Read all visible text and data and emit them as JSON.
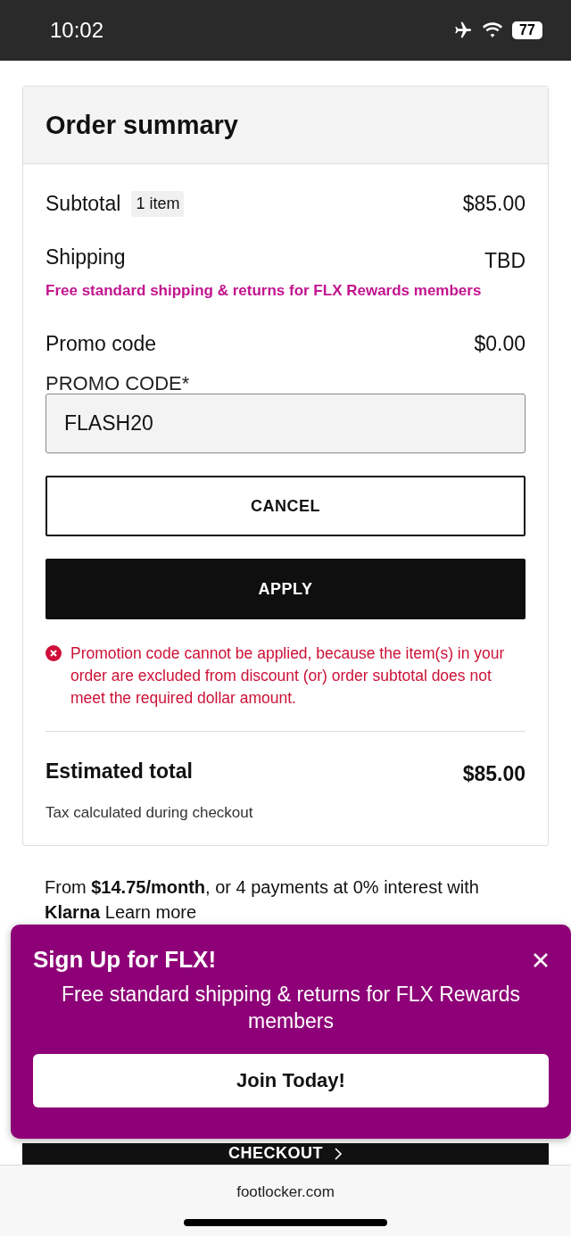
{
  "status_bar": {
    "time": "10:02",
    "battery": "77"
  },
  "order_summary": {
    "title": "Order summary",
    "subtotal": {
      "label": "Subtotal",
      "badge": "1 item",
      "value": "$85.00"
    },
    "shipping": {
      "label": "Shipping",
      "value": "TBD",
      "note": "Free standard shipping & returns for FLX Rewards members"
    },
    "promo": {
      "label": "Promo code",
      "value": "$0.00",
      "field_label": "PROMO CODE*",
      "field_value": "FLASH20",
      "cancel": "CANCEL",
      "apply": "APPLY",
      "error": "Promotion code cannot be applied, because the item(s) in your order are excluded from discount (or) order subtotal does not meet the required dollar amount."
    },
    "total": {
      "label": "Estimated total",
      "value": "$85.00",
      "note": "Tax calculated during checkout"
    }
  },
  "installments": "From **$14.75/month**, or 4 payments at 0% interest with **Klarna** Learn more",
  "checkout": {
    "label": "CHECKOUT"
  },
  "popup": {
    "title": "Sign Up for FLX!",
    "text": "Free standard shipping & returns for FLX Rewards members",
    "button": "Join Today!"
  },
  "browser": {
    "url": "footlocker.com"
  }
}
